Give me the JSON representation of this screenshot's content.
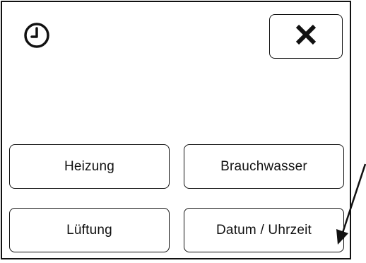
{
  "header": {
    "clock_icon": "clock-icon",
    "close_icon": "close-icon"
  },
  "menu": {
    "items": [
      {
        "label": "Heizung"
      },
      {
        "label": "Brauchwasser"
      },
      {
        "label": "Lüftung"
      },
      {
        "label": "Datum / Uhrzeit"
      }
    ]
  },
  "annotation": {
    "pointer": "arrow-icon"
  }
}
